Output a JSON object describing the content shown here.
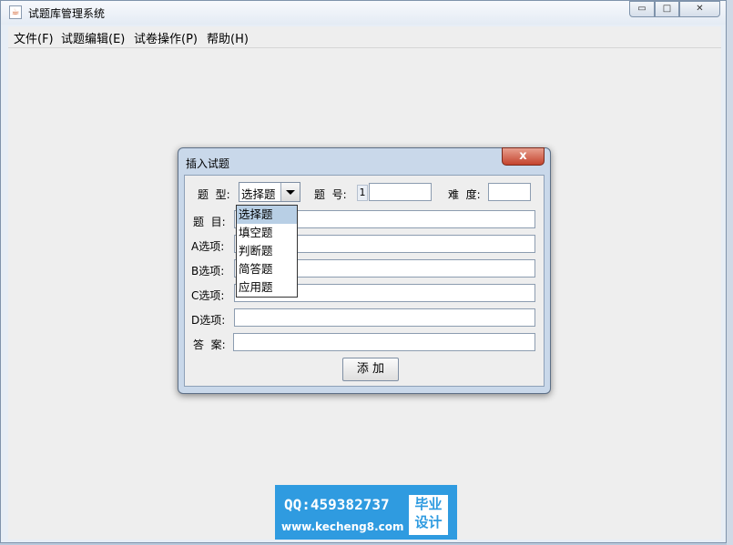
{
  "window": {
    "title": "试题库管理系统",
    "icon": "java-cup-icon",
    "min": "▭",
    "max": "□",
    "close": "✕"
  },
  "menu": [
    {
      "label": "文件(F)"
    },
    {
      "label": "试题编辑(E)"
    },
    {
      "label": "试卷操作(P)"
    },
    {
      "label": "帮助(H)"
    }
  ],
  "dialog": {
    "title": "插入试题",
    "close": "x",
    "labels": {
      "type": "题  型:",
      "number": "题  号:",
      "difficulty": "难  度:",
      "question": "题  目:",
      "a": "A选项:",
      "b": "B选项:",
      "c": "C选项:",
      "d": "D选项:",
      "answer": "答  案:"
    },
    "type_selected": "选择题",
    "number_value": "1",
    "fields": {
      "number": "",
      "difficulty": "",
      "question": "",
      "a": "",
      "b": "",
      "c": "",
      "d": "",
      "answer": ""
    },
    "type_options": [
      "选择题",
      "填空题",
      "判断题",
      "简答题",
      "应用题"
    ],
    "add_button": "添 加"
  },
  "watermark": {
    "qq": "QQ:459382737",
    "url": "www.kecheng8.com",
    "badge_line1": "毕业",
    "badge_line2": "设计"
  }
}
